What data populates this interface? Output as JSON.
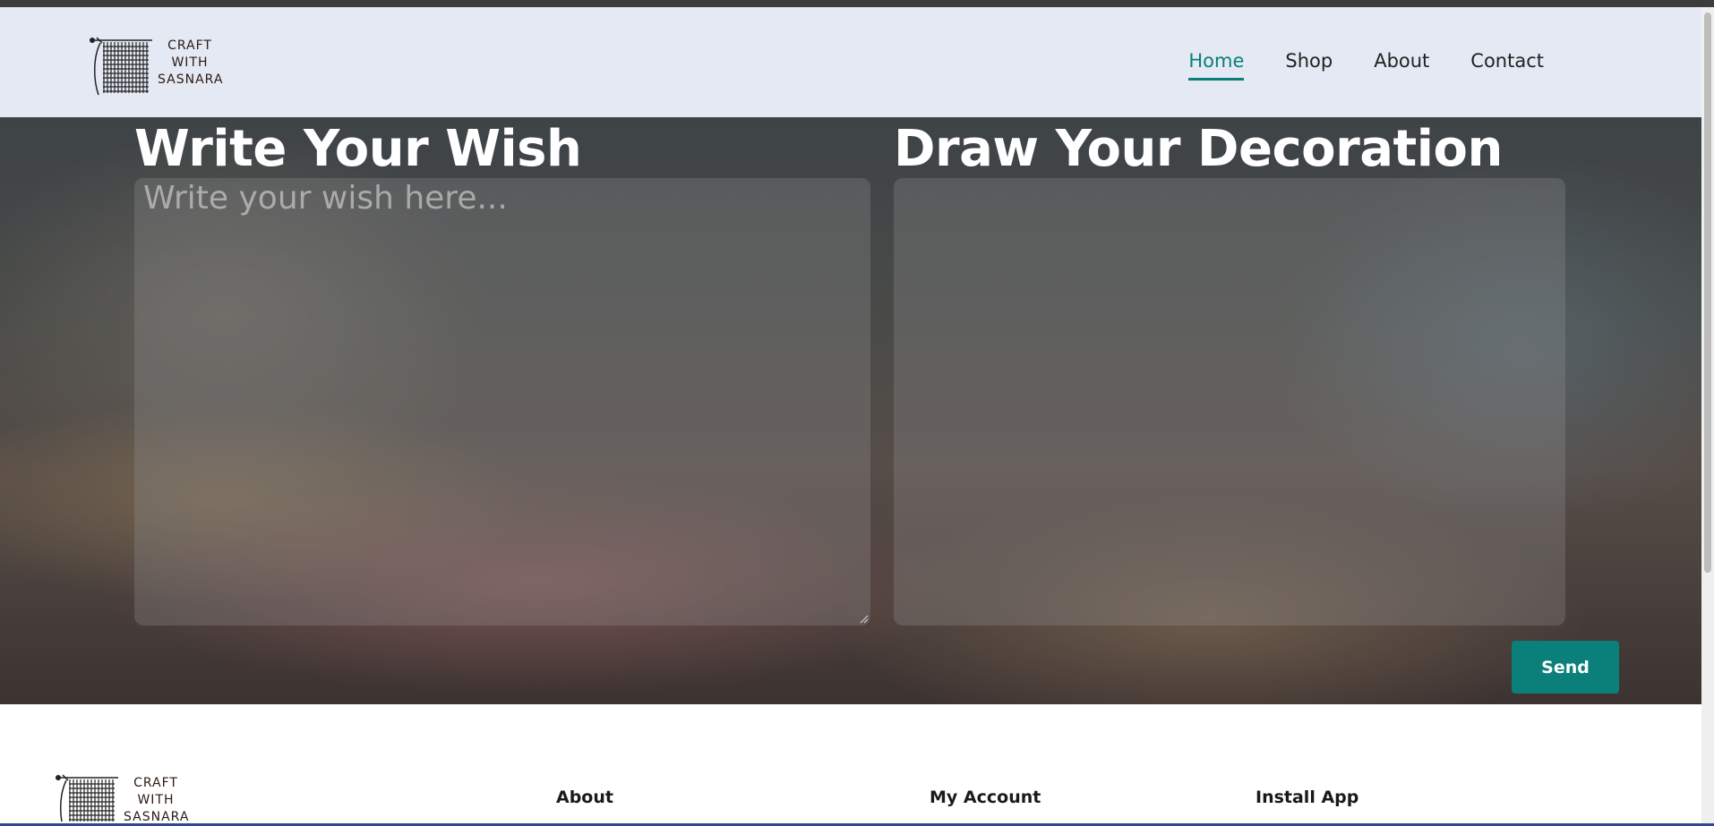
{
  "brand": {
    "logo_lines": [
      "CRAFT",
      "WITH",
      "SASNARA"
    ]
  },
  "nav": {
    "items": [
      {
        "label": "Home",
        "active": true
      },
      {
        "label": "Shop",
        "active": false
      },
      {
        "label": "About",
        "active": false
      },
      {
        "label": "Contact",
        "active": false
      }
    ]
  },
  "hero": {
    "wish_title": "Write Your Wish",
    "wish_placeholder": "Write your wish here...",
    "draw_title": "Draw Your Decoration",
    "send_label": "Send"
  },
  "footer": {
    "headings": [
      "About",
      "My Account",
      "Install App"
    ]
  },
  "colors": {
    "accent": "#0b7f7a",
    "header_bg": "#e4e9f4"
  }
}
